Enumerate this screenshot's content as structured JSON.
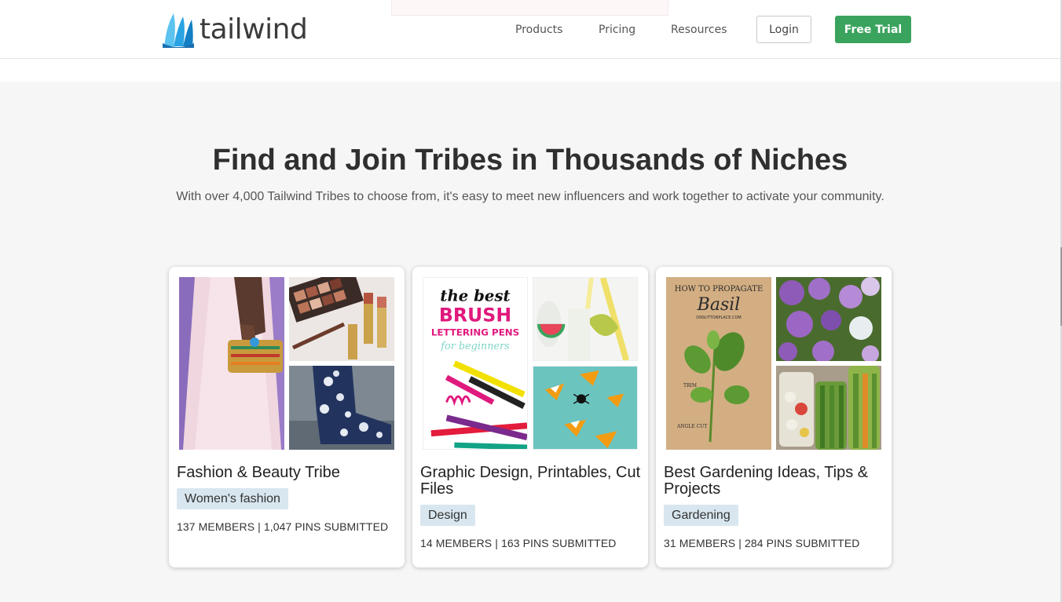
{
  "header": {
    "logo_text": "tailwind",
    "nav": [
      "Products",
      "Pricing",
      "Resources"
    ],
    "login_label": "Login",
    "trial_label": "Free Trial",
    "brand_color": "#1a8fd6",
    "cta_color": "#3aa35d"
  },
  "hero": {
    "title": "Find and Join Tribes in Thousands of Niches",
    "subtitle": "With over 4,000 Tailwind Tribes to choose from, it's easy to meet new influencers and work together to activate your community."
  },
  "tribes": [
    {
      "title": "Fashion & Beauty Tribe",
      "tag": "Women's fashion",
      "stats": "137 MEMBERS | 1,047 PINS SUBMITTED"
    },
    {
      "title": "Graphic Design, Printables, Cut Files",
      "tag": "Design",
      "stats": "14 MEMBERS | 163 PINS SUBMITTED",
      "image_text": {
        "line1": "the best",
        "line2": "BRUSH",
        "line3": "LETTERING PENS",
        "line4": "for beginners"
      }
    },
    {
      "title": "Best Gardening Ideas, Tips & Projects",
      "tag": "Gardening",
      "stats": "31 MEMBERS | 284 PINS SUBMITTED",
      "image_text": {
        "line1": "HOW TO PROPAGATE",
        "line2": "Basil",
        "line3": "ONSUTTONPLACE.COM",
        "line4": "TRIM",
        "line5": "ANGLE CUT"
      }
    }
  ]
}
